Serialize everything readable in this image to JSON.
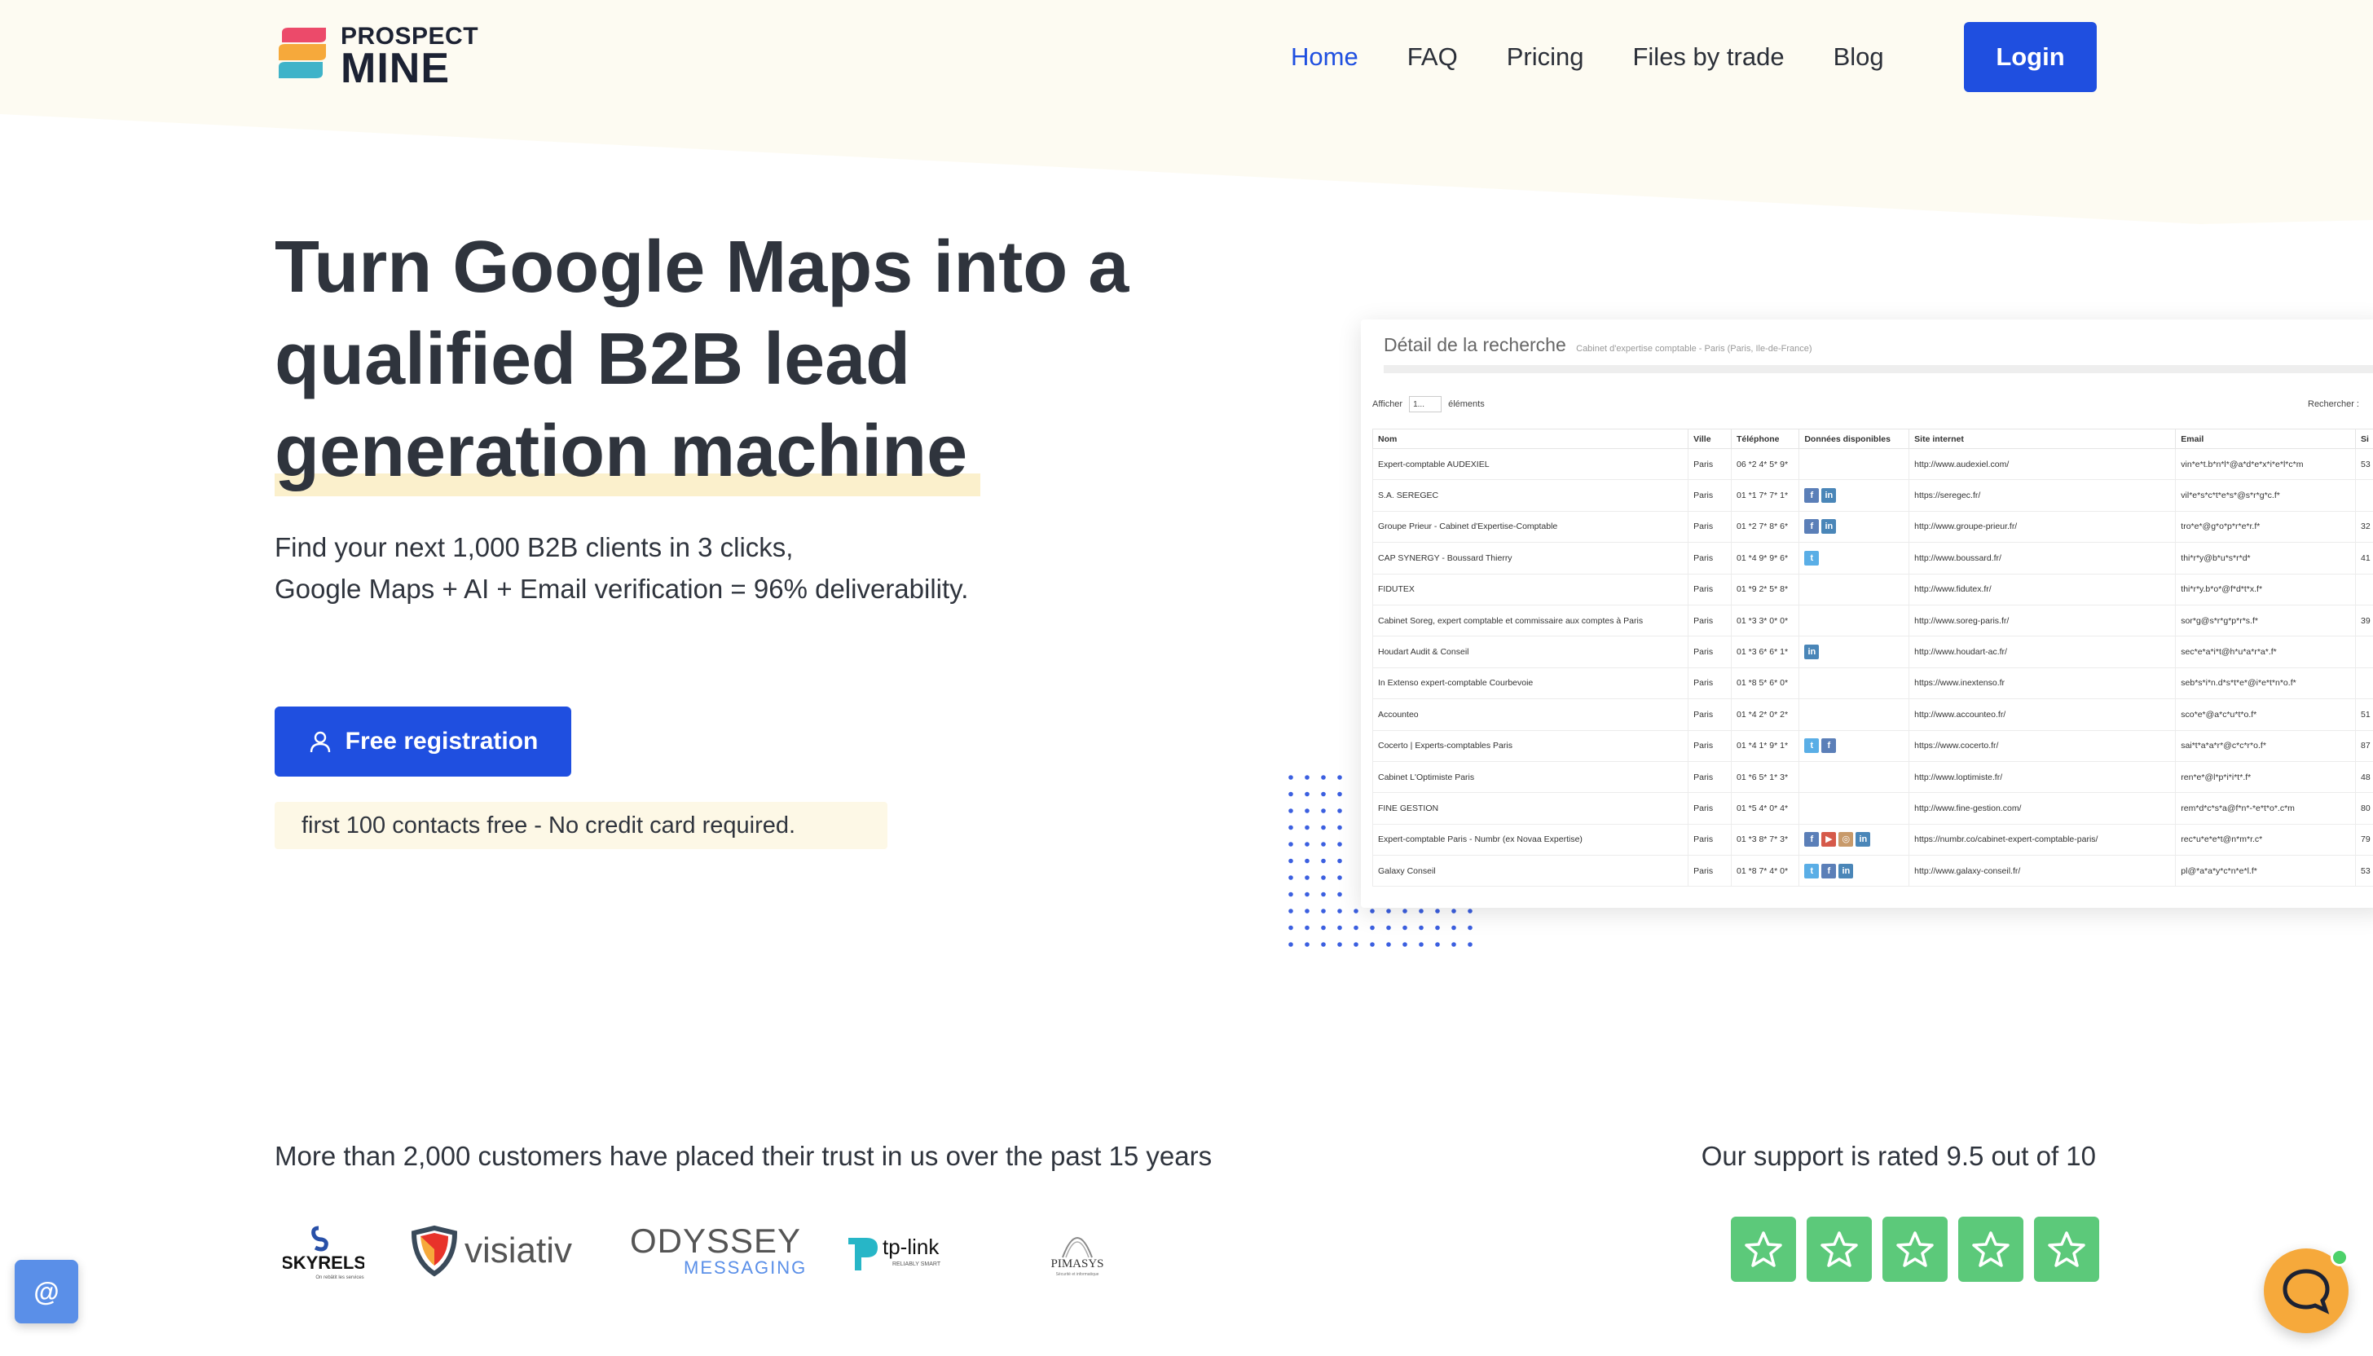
{
  "brand": {
    "logo_top": "PROSPECT",
    "logo_bottom": "MINE"
  },
  "nav": {
    "items": [
      {
        "label": "Home",
        "active": true
      },
      {
        "label": "FAQ",
        "active": false
      },
      {
        "label": "Pricing",
        "active": false
      },
      {
        "label": "Files by trade",
        "active": false
      },
      {
        "label": "Blog",
        "active": false
      }
    ],
    "login_label": "Login"
  },
  "hero": {
    "title_line1": "Turn Google Maps into a",
    "title_line2": "qualified B2B lead",
    "title_line3": "generation machine",
    "subtitle_line1": "Find your next 1,000 B2B clients in 3 clicks,",
    "subtitle_line2": "Google Maps + AI + Email verification = 96% deliverability.",
    "cta_label": "Free registration",
    "note": "first 100 contacts free - No credit card required."
  },
  "preview": {
    "title": "Détail de la recherche",
    "subtitle": "Cabinet d'expertise comptable - Paris (Paris, Ile-de-France)",
    "show_label": "Afficher",
    "show_value": "1...",
    "elements_label": "éléments",
    "search_label": "Rechercher :",
    "columns": [
      "Nom",
      "Ville",
      "Téléphone",
      "Données disponibles",
      "Site internet",
      "Email",
      "Si"
    ],
    "rows": [
      {
        "name": "Expert-comptable AUDEXIEL",
        "city": "Paris",
        "phone": "06 *2 4* 5* 9*",
        "social": [],
        "site": "http://www.audexiel.com/",
        "email": "vin*e*t.b*n*l*@a*d*e*x*i*e*l*c*m",
        "si": "53"
      },
      {
        "name": "S.A. SEREGEC",
        "city": "Paris",
        "phone": "01 *1 7* 7* 1*",
        "social": [
          "facebook",
          "linkedin"
        ],
        "site": "https://seregec.fr/",
        "email": "vil*e*s*c*t*e*s*@s*r*g*c.f*",
        "si": ""
      },
      {
        "name": "Groupe Prieur - Cabinet d'Expertise-Comptable",
        "city": "Paris",
        "phone": "01 *2 7* 8* 6*",
        "social": [
          "facebook",
          "linkedin"
        ],
        "site": "http://www.groupe-prieur.fr/",
        "email": "tro*e*@g*o*p*r*e*r.f*",
        "si": "32"
      },
      {
        "name": "CAP SYNERGY - Boussard Thierry",
        "city": "Paris",
        "phone": "01 *4 9* 9* 6*",
        "social": [
          "twitter"
        ],
        "site": "http://www.boussard.fr/",
        "email": "thi*r*y@b*u*s*r*d*",
        "si": "41"
      },
      {
        "name": "FIDUTEX",
        "city": "Paris",
        "phone": "01 *9 2* 5* 8*",
        "social": [],
        "site": "http://www.fidutex.fr/",
        "email": "thi*r*y.b*o*@f*d*t*x.f*",
        "si": ""
      },
      {
        "name": "Cabinet Soreg, expert comptable et commissaire aux comptes à Paris",
        "city": "Paris",
        "phone": "01 *3 3* 0* 0*",
        "social": [],
        "site": "http://www.soreg-paris.fr/",
        "email": "sor*g@s*r*g*p*r*s.f*",
        "si": "39"
      },
      {
        "name": "Houdart Audit & Conseil",
        "city": "Paris",
        "phone": "01 *3 6* 6* 1*",
        "social": [
          "linkedin"
        ],
        "site": "http://www.houdart-ac.fr/",
        "email": "sec*e*a*i*t@h*u*a*r*a*.f*",
        "si": ""
      },
      {
        "name": "In Extenso expert-comptable Courbevoie",
        "city": "Paris",
        "phone": "01 *8 5* 6* 0*",
        "social": [],
        "site": "https://www.inextenso.fr",
        "email": "seb*s*i*n.d*s*t*e*@i*e*t*n*o.f*",
        "si": ""
      },
      {
        "name": "Accounteo",
        "city": "Paris",
        "phone": "01 *4 2* 0* 2*",
        "social": [],
        "site": "http://www.accounteo.fr/",
        "email": "sco*e*@a*c*u*t*o.f*",
        "si": "51"
      },
      {
        "name": "Cocerto | Experts-comptables Paris",
        "city": "Paris",
        "phone": "01 *4 1* 9* 1*",
        "social": [
          "twitter",
          "facebook"
        ],
        "site": "https://www.cocerto.fr/",
        "email": "sai*t*a*a*r*@c*c*r*o.f*",
        "si": "87"
      },
      {
        "name": "Cabinet L'Optimiste Paris",
        "city": "Paris",
        "phone": "01 *6 5* 1* 3*",
        "social": [],
        "site": "http://www.loptimiste.fr/",
        "email": "ren*e*@l*p*i*i*t*.f*",
        "si": "48"
      },
      {
        "name": "FINE GESTION",
        "city": "Paris",
        "phone": "01 *5 4* 0* 4*",
        "social": [],
        "site": "http://www.fine-gestion.com/",
        "email": "rem*d*c*s*a@f*n*-*e*t*o*.c*m",
        "si": "80"
      },
      {
        "name": "Expert-comptable Paris - Numbr (ex Novaa Expertise)",
        "city": "Paris",
        "phone": "01 *3 8* 7* 3*",
        "social": [
          "facebook",
          "youtube",
          "instagram",
          "linkedin"
        ],
        "site": "https://numbr.co/cabinet-expert-comptable-paris/",
        "email": "rec*u*e*e*t@n*m*r.c*",
        "si": "79"
      },
      {
        "name": "Galaxy Conseil",
        "city": "Paris",
        "phone": "01 *8 7* 4* 0*",
        "social": [
          "twitter",
          "facebook",
          "linkedin"
        ],
        "site": "http://www.galaxy-conseil.fr/",
        "email": "pl@*a*a*y*c*n*e*l.f*",
        "si": "53"
      }
    ]
  },
  "trust": {
    "text": "More than 2,000 customers have placed their trust in us over the past 15 years",
    "support_text": "Our support is rated 9.5 out of 10",
    "logos": [
      {
        "name": "SKYRELS",
        "tagline": "On rebâtit les services"
      },
      {
        "name": "visiativ"
      },
      {
        "name": "ODYSSEY",
        "sub": "MESSAGING"
      },
      {
        "name": "tp-link",
        "tagline": "RELIABLY SMART"
      },
      {
        "name": "PIMASYS",
        "tagline": "Sécurité et informatique"
      }
    ],
    "stars": 5
  },
  "widgets": {
    "at_label": "@"
  },
  "colors": {
    "primary": "#1f4fe0",
    "highlight": "#fbf0cc",
    "star": "#5cc97a",
    "chat": "#f6a93b"
  }
}
